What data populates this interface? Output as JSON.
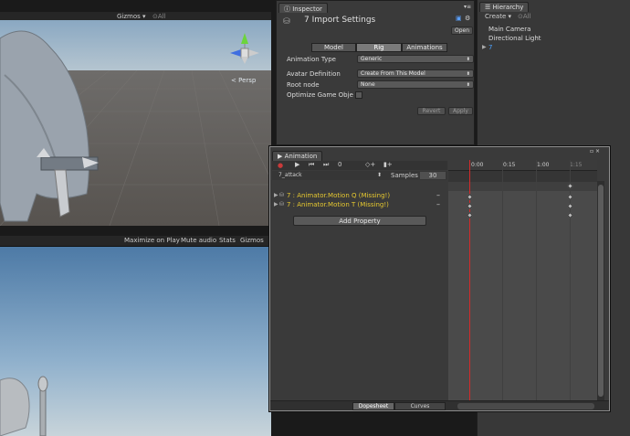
{
  "scene_top": {
    "gizmos_label": "Gizmos",
    "search_placeholder": "All",
    "persp_label": "Persp"
  },
  "game_view": {
    "toolbar": [
      "Maximize on Play",
      "Mute audio",
      "Stats",
      "Gizmos"
    ]
  },
  "inspector": {
    "tab_label": "Inspector",
    "title": "7 Import Settings",
    "open_button": "Open",
    "tabs": [
      "Model",
      "Rig",
      "Animations"
    ],
    "active_tab": "Rig",
    "animation_type_label": "Animation Type",
    "animation_type_value": "Generic",
    "avatar_definition_label": "Avatar Definition",
    "avatar_definition_value": "Create From This Model",
    "root_node_label": "Root node",
    "root_node_value": "None",
    "optimize_label": "Optimize Game Obje",
    "revert_button": "Revert",
    "apply_button": "Apply"
  },
  "hierarchy": {
    "tab_label": "Hierarchy",
    "create_label": "Create",
    "search_placeholder": "All",
    "items": [
      "Main Camera",
      "Directional Light",
      "7"
    ]
  },
  "animation": {
    "tab_label": "Animation",
    "frame_value": "0",
    "clip_name": "7_attack",
    "samples_label": "Samples",
    "samples_value": "30",
    "timeline_labels": [
      "0:00",
      "0:15",
      "1:00",
      "1:15"
    ],
    "properties": [
      "7 : Animator.Motion Q (Missing!)",
      "7 : Animator.Motion T (Missing!)"
    ],
    "add_property_button": "Add Property",
    "bottom_tabs": [
      "Dopesheet",
      "Curves"
    ]
  },
  "colors": {
    "missing_property": "#e6c830",
    "playhead": "#d42a2a",
    "hierarchy_selected": "#4da3ff"
  }
}
